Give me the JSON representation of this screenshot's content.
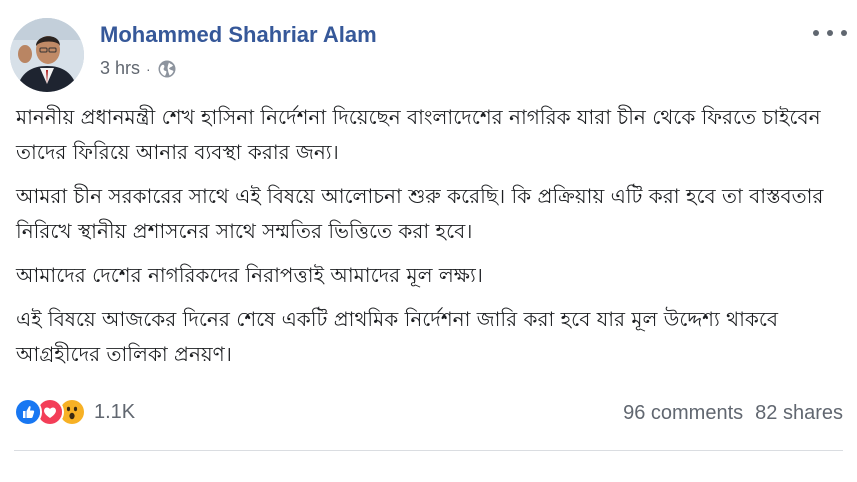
{
  "post": {
    "author": "Mohammed Shahriar Alam",
    "time": "3 hrs",
    "separator": "·",
    "privacy_icon": "globe-icon",
    "menu_icon": "more-options-icon",
    "paragraphs": [
      "মাননীয় প্রধানমন্ত্রী শেখ হাসিনা নির্দেশনা দিয়েছেন বাংলাদেশের নাগরিক যারা চীন থেকে ফিরতে চাইবেন তাদের ফিরিয়ে আনার ব্যবস্থা করার জন্য।",
      "আমরা চীন সরকারের সাথে এই বিষয়ে আলোচনা শুরু করেছি। কি প্রক্রিয়ায় এটি করা হবে তা বাস্তবতার নিরিখে স্থানীয় প্রশাসনের সাথে সম্মতির ভিত্তিতে করা হবে।",
      "আমাদের দেশের নাগরিকদের নিরাপত্তাই আমাদের মূল লক্ষ্য।",
      "এই বিষয়ে আজকের দিনের শেষে একটি প্রাথমিক নির্দেশনা জারি করা হবে যার মূল উদ্দেশ্য থাকবে আগ্রহীদের তালিকা প্রনয়ণ।"
    ]
  },
  "footer": {
    "reactions": [
      "like-icon",
      "love-icon",
      "wow-icon"
    ],
    "reaction_count": "1.1K",
    "comments": "96 comments",
    "shares": "82 shares"
  },
  "colors": {
    "author": "#365899",
    "meta": "#616770",
    "like": "#1877f2",
    "love": "#f33e58",
    "wow": "#f7b125"
  }
}
